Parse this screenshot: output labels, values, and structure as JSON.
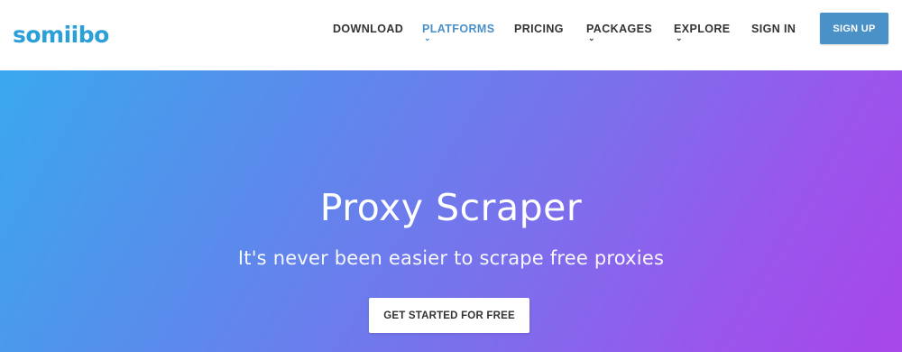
{
  "header": {
    "logo_text": "somiibo",
    "nav": {
      "download": "DOWNLOAD",
      "platforms": "PLATFORMS",
      "pricing": "PRICING",
      "packages": "PACKAGES",
      "explore": "EXPLORE",
      "signin": "SIGN IN"
    },
    "caret_glyph": "⌄",
    "signup_label": "SIGN UP",
    "active_nav": "PLATFORMS"
  },
  "hero": {
    "title": "Proxy Scraper",
    "subtitle": "It's never been easier to scrape free proxies",
    "cta_label": "GET STARTED FOR FREE"
  },
  "colors": {
    "brand": "#2b9fd8",
    "nav_active": "#4a90c8",
    "signup_bg": "#4a91c7",
    "hero_gradient_start": "#3aa8ee",
    "hero_gradient_end": "#a747ea"
  }
}
